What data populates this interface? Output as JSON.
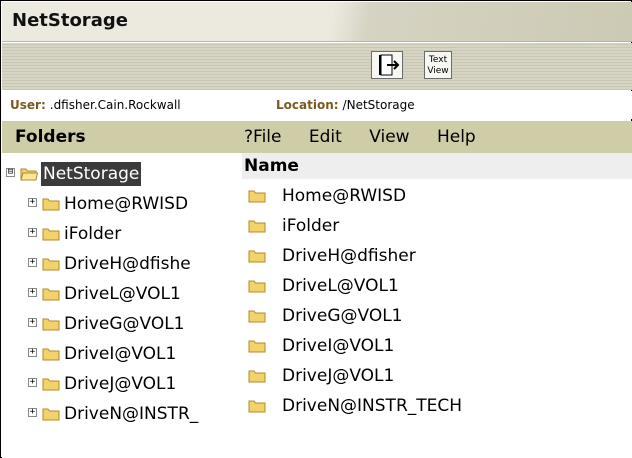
{
  "app": {
    "title": "NetStorage"
  },
  "toolbar": {
    "logout_icon": "logout-door-icon",
    "textview_label_1": "Text",
    "textview_label_2": "View"
  },
  "info": {
    "user_label": "User:",
    "user_value": ".dfisher.Cain.Rockwall",
    "location_label": "Location:",
    "location_value": "/NetStorage"
  },
  "folders": {
    "header": "Folders",
    "root": {
      "expander": "⊟",
      "label": "NetStorage"
    },
    "items": [
      {
        "expander": "+",
        "label": "Home@RWISD"
      },
      {
        "expander": "+",
        "label": "iFolder"
      },
      {
        "expander": "+",
        "label": "DriveH@dfishe"
      },
      {
        "expander": "+",
        "label": "DriveL@VOL1"
      },
      {
        "expander": "+",
        "label": "DriveG@VOL1"
      },
      {
        "expander": "+",
        "label": "DriveI@VOL1"
      },
      {
        "expander": "+",
        "label": "DriveJ@VOL1"
      },
      {
        "expander": "+",
        "label": "DriveN@INSTR_"
      }
    ]
  },
  "menu": {
    "items": [
      "?File",
      "Edit",
      "View",
      "Help"
    ]
  },
  "content": {
    "column_header": "Name",
    "rows": [
      {
        "label": "Home@RWISD"
      },
      {
        "label": "iFolder"
      },
      {
        "label": "DriveH@dfisher"
      },
      {
        "label": "DriveL@VOL1"
      },
      {
        "label": "DriveG@VOL1"
      },
      {
        "label": "DriveI@VOL1"
      },
      {
        "label": "DriveJ@VOL1"
      },
      {
        "label": "DriveN@INSTR_TECH"
      }
    ]
  },
  "colors": {
    "accent": "#cfcca8",
    "folder_yellow": "#f3d26a",
    "folder_outline": "#b08a2a",
    "selection": "#3b3b3b"
  }
}
